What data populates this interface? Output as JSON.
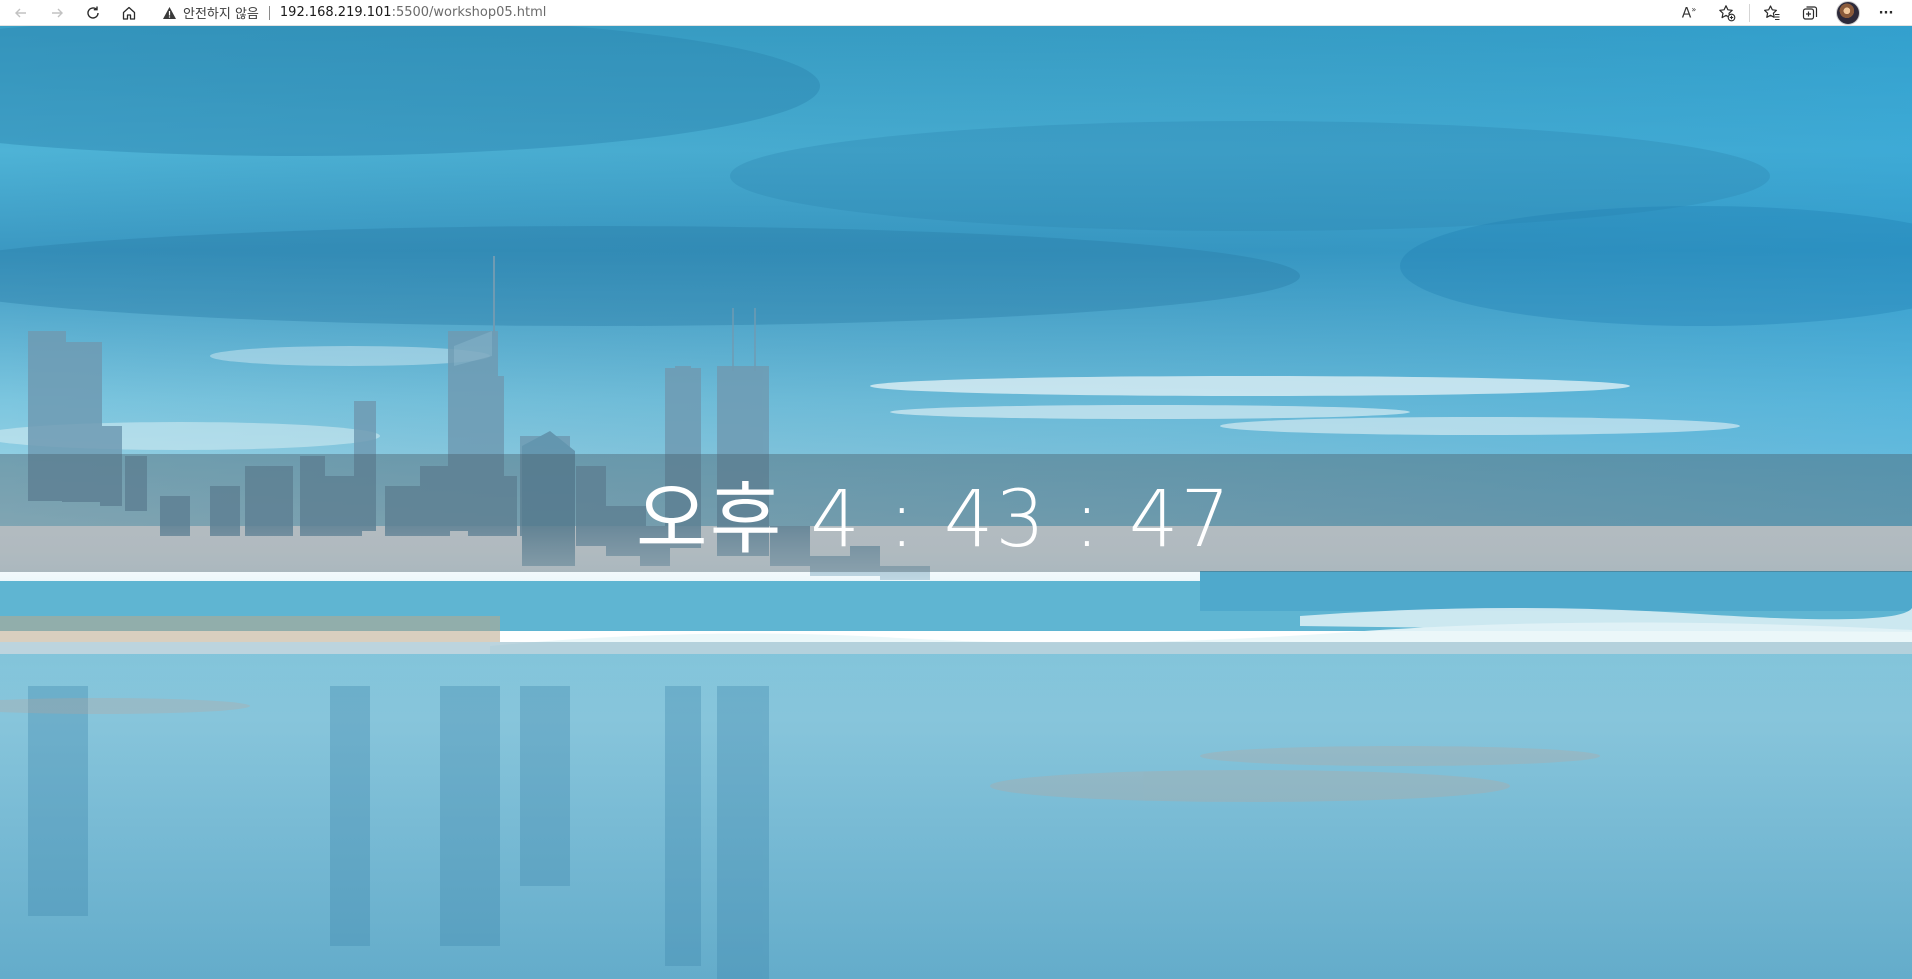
{
  "browser": {
    "security_label": "안전하지 않음",
    "url_host": "192.168.219.101",
    "url_path": ":5500/workshop05.html",
    "icons": {
      "back": "arrow-left-icon",
      "forward": "arrow-right-icon",
      "refresh": "refresh-icon",
      "home": "home-icon",
      "warning": "warning-icon",
      "read_aloud": "read-aloud-icon",
      "add_favorite": "star-add-icon",
      "favorites": "favorites-icon",
      "collections": "collections-icon",
      "profile": "avatar",
      "more": "more-icon"
    },
    "read_aloud_glyph": "A",
    "more_glyph": "···"
  },
  "clock": {
    "ampm": "오후",
    "hours": "4",
    "minutes": "43",
    "seconds": "47",
    "separator": ":"
  },
  "colors": {
    "sky_top": "#2e8fb8",
    "sky_mid": "#58b8d8",
    "sea": "#6ab7d4",
    "band": "#485c68"
  }
}
